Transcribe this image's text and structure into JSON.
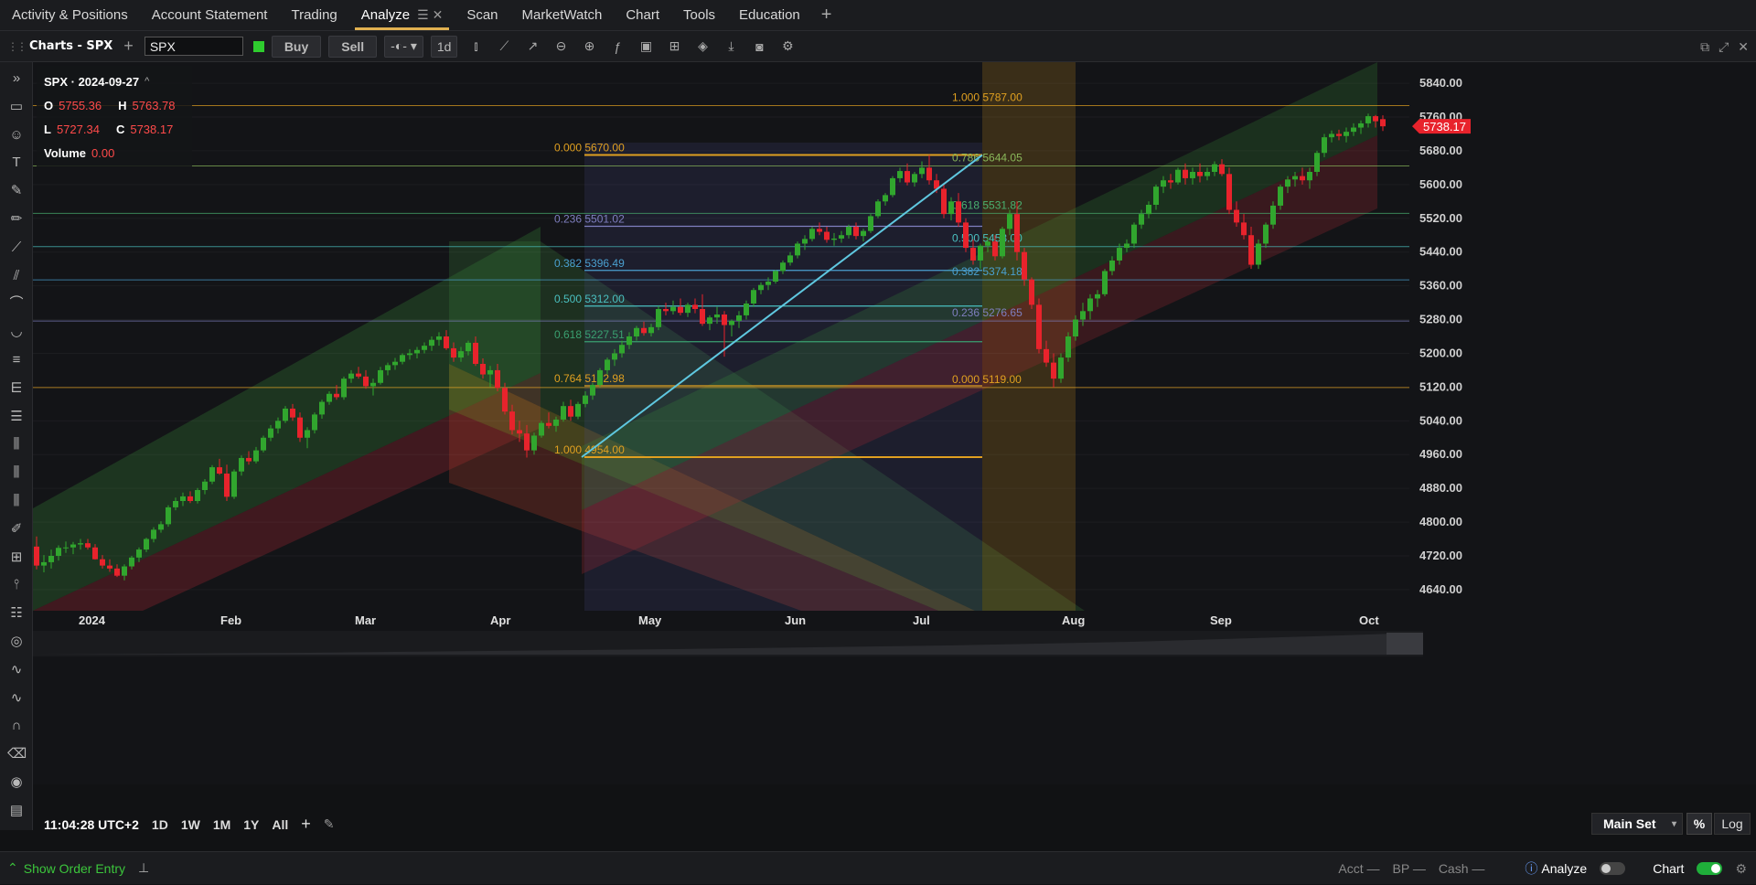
{
  "top_tabs": [
    {
      "label": "Activity & Positions"
    },
    {
      "label": "Account Statement"
    },
    {
      "label": "Trading"
    },
    {
      "label": "Analyze",
      "active": true
    },
    {
      "label": "Scan"
    },
    {
      "label": "MarketWatch"
    },
    {
      "label": "Chart"
    },
    {
      "label": "Tools"
    },
    {
      "label": "Education"
    }
  ],
  "toolbar": {
    "title": "Charts - SPX",
    "symbol": "SPX",
    "buy_label": "Buy",
    "sell_label": "Sell",
    "interval": "1d"
  },
  "ohlc": {
    "header": "SPX · 2024-09-27",
    "open": "5755.36",
    "high": "5763.78",
    "low": "5727.34",
    "close": "5738.17",
    "volume": "0.00"
  },
  "left_tools": [
    "expand-icon",
    "comment-icon",
    "emoji-icon",
    "text-icon",
    "brush-icon",
    "pencil-icon",
    "trendline-icon",
    "channel-icon",
    "arc-icon",
    "curve-icon",
    "lines-icon",
    "fib-icon",
    "parallel-icon",
    "bars-icon",
    "vlines-icon",
    "hlines-icon",
    "note-icon",
    "grid-icon",
    "pitchfork-icon",
    "pattern-icon",
    "spiral-icon",
    "wave-icon",
    "wave2-icon",
    "magnet-icon",
    "eraser-icon",
    "eye-icon",
    "layers-icon"
  ],
  "bottom": {
    "time": "11:04:28 UTC+2",
    "ranges": [
      "1D",
      "1W",
      "1M",
      "1Y",
      "All"
    ],
    "main_set": "Main Set",
    "pct": "%",
    "log": "Log"
  },
  "status": {
    "show_order": "Show Order Entry",
    "acct": "Acct —",
    "bp": "BP —",
    "cash": "Cash —",
    "analyze": "Analyze",
    "chart": "Chart"
  },
  "colors": {
    "up": "#31a62e",
    "down": "#e8232c",
    "accent": "#e0b050",
    "price_tag": "#e8232c"
  },
  "chart_data": {
    "type": "candlestick",
    "symbol": "SPX",
    "x_labels": [
      "2024",
      "Feb",
      "Mar",
      "Apr",
      "May",
      "Jun",
      "Jul",
      "Aug",
      "Sep",
      "Oct"
    ],
    "y_ticks": [
      5840,
      5760,
      5680,
      5600,
      5520,
      5440,
      5360,
      5280,
      5200,
      5120,
      5040,
      4960,
      4880,
      4800,
      4720,
      4640
    ],
    "ylim": [
      4590,
      5890
    ],
    "last_price": "5738.17",
    "candles": [
      [
        4742,
        4766,
        4688,
        4697
      ],
      [
        4697,
        4722,
        4681,
        4705
      ],
      [
        4705,
        4735,
        4690,
        4720
      ],
      [
        4720,
        4745,
        4709,
        4739
      ],
      [
        4739,
        4754,
        4727,
        4740
      ],
      [
        4740,
        4753,
        4724,
        4747
      ],
      [
        4747,
        4760,
        4735,
        4750
      ],
      [
        4750,
        4760,
        4735,
        4740
      ],
      [
        4740,
        4748,
        4711,
        4712
      ],
      [
        4712,
        4722,
        4690,
        4697
      ],
      [
        4697,
        4712,
        4682,
        4690
      ],
      [
        4690,
        4700,
        4670,
        4673
      ],
      [
        4673,
        4700,
        4662,
        4695
      ],
      [
        4695,
        4720,
        4688,
        4716
      ],
      [
        4716,
        4740,
        4705,
        4735
      ],
      [
        4735,
        4763,
        4729,
        4760
      ],
      [
        4760,
        4788,
        4752,
        4782
      ],
      [
        4782,
        4802,
        4775,
        4795
      ],
      [
        4795,
        4840,
        4789,
        4835
      ],
      [
        4835,
        4858,
        4828,
        4850
      ],
      [
        4850,
        4870,
        4838,
        4861
      ],
      [
        4861,
        4873,
        4845,
        4850
      ],
      [
        4850,
        4881,
        4844,
        4876
      ],
      [
        4876,
        4902,
        4866,
        4896
      ],
      [
        4896,
        4935,
        4890,
        4930
      ],
      [
        4930,
        4950,
        4912,
        4915
      ],
      [
        4915,
        4936,
        4850,
        4860
      ],
      [
        4860,
        4925,
        4855,
        4920
      ],
      [
        4920,
        4958,
        4910,
        4952
      ],
      [
        4952,
        4968,
        4936,
        4944
      ],
      [
        4944,
        4978,
        4939,
        4970
      ],
      [
        4970,
        5005,
        4965,
        5000
      ],
      [
        5000,
        5030,
        4992,
        5022
      ],
      [
        5022,
        5048,
        5010,
        5040
      ],
      [
        5040,
        5075,
        5035,
        5069
      ],
      [
        5069,
        5080,
        5040,
        5048
      ],
      [
        5048,
        5060,
        4990,
        5000
      ],
      [
        5000,
        5025,
        4975,
        5018
      ],
      [
        5018,
        5060,
        5010,
        5055
      ],
      [
        5055,
        5090,
        5045,
        5085
      ],
      [
        5085,
        5110,
        5078,
        5104
      ],
      [
        5104,
        5125,
        5090,
        5096
      ],
      [
        5096,
        5145,
        5090,
        5140
      ],
      [
        5140,
        5160,
        5130,
        5152
      ],
      [
        5152,
        5168,
        5140,
        5145
      ],
      [
        5145,
        5160,
        5116,
        5122
      ],
      [
        5122,
        5140,
        5100,
        5130
      ],
      [
        5130,
        5168,
        5126,
        5160
      ],
      [
        5160,
        5178,
        5148,
        5172
      ],
      [
        5172,
        5189,
        5161,
        5180
      ],
      [
        5180,
        5200,
        5174,
        5196
      ],
      [
        5196,
        5210,
        5185,
        5200
      ],
      [
        5200,
        5215,
        5188,
        5208
      ],
      [
        5208,
        5226,
        5200,
        5218
      ],
      [
        5218,
        5240,
        5206,
        5232
      ],
      [
        5232,
        5250,
        5218,
        5240
      ],
      [
        5240,
        5255,
        5208,
        5212
      ],
      [
        5212,
        5226,
        5180,
        5190
      ],
      [
        5190,
        5215,
        5180,
        5205
      ],
      [
        5205,
        5230,
        5195,
        5225
      ],
      [
        5225,
        5240,
        5170,
        5175
      ],
      [
        5175,
        5188,
        5140,
        5150
      ],
      [
        5150,
        5170,
        5120,
        5160
      ],
      [
        5160,
        5175,
        5110,
        5118
      ],
      [
        5118,
        5130,
        5055,
        5062
      ],
      [
        5062,
        5078,
        5008,
        5018
      ],
      [
        5018,
        5040,
        4990,
        5010
      ],
      [
        5010,
        5030,
        4953,
        4970
      ],
      [
        4970,
        5012,
        4960,
        5005
      ],
      [
        5005,
        5040,
        5000,
        5035
      ],
      [
        5035,
        5060,
        5022,
        5028
      ],
      [
        5028,
        5050,
        5014,
        5043
      ],
      [
        5043,
        5085,
        5038,
        5075
      ],
      [
        5075,
        5090,
        5040,
        5050
      ],
      [
        5050,
        5085,
        5044,
        5080
      ],
      [
        5080,
        5110,
        5072,
        5100
      ],
      [
        5100,
        5130,
        5090,
        5125
      ],
      [
        5125,
        5165,
        5120,
        5160
      ],
      [
        5160,
        5190,
        5150,
        5185
      ],
      [
        5185,
        5210,
        5170,
        5200
      ],
      [
        5200,
        5230,
        5190,
        5220
      ],
      [
        5220,
        5250,
        5210,
        5240
      ],
      [
        5240,
        5265,
        5230,
        5260
      ],
      [
        5260,
        5275,
        5242,
        5248
      ],
      [
        5248,
        5270,
        5240,
        5262
      ],
      [
        5262,
        5312,
        5255,
        5305
      ],
      [
        5305,
        5320,
        5290,
        5300
      ],
      [
        5300,
        5325,
        5292,
        5310
      ],
      [
        5310,
        5330,
        5290,
        5296
      ],
      [
        5296,
        5320,
        5286,
        5315
      ],
      [
        5315,
        5330,
        5295,
        5305
      ],
      [
        5305,
        5340,
        5265,
        5270
      ],
      [
        5270,
        5290,
        5255,
        5285
      ],
      [
        5285,
        5310,
        5270,
        5292
      ],
      [
        5292,
        5300,
        5192,
        5267
      ],
      [
        5267,
        5280,
        5240,
        5277
      ],
      [
        5277,
        5300,
        5260,
        5290
      ],
      [
        5290,
        5325,
        5280,
        5318
      ],
      [
        5318,
        5355,
        5310,
        5350
      ],
      [
        5350,
        5368,
        5340,
        5362
      ],
      [
        5362,
        5380,
        5350,
        5370
      ],
      [
        5370,
        5398,
        5365,
        5395
      ],
      [
        5395,
        5420,
        5388,
        5415
      ],
      [
        5415,
        5440,
        5408,
        5432
      ],
      [
        5432,
        5465,
        5425,
        5460
      ],
      [
        5460,
        5480,
        5445,
        5471
      ],
      [
        5471,
        5500,
        5465,
        5495
      ],
      [
        5495,
        5510,
        5480,
        5488
      ],
      [
        5488,
        5500,
        5462,
        5469
      ],
      [
        5469,
        5485,
        5455,
        5472
      ],
      [
        5472,
        5490,
        5462,
        5480
      ],
      [
        5480,
        5505,
        5472,
        5500
      ],
      [
        5500,
        5510,
        5470,
        5478
      ],
      [
        5478,
        5495,
        5465,
        5490
      ],
      [
        5490,
        5530,
        5485,
        5525
      ],
      [
        5525,
        5565,
        5520,
        5560
      ],
      [
        5560,
        5580,
        5550,
        5575
      ],
      [
        5575,
        5620,
        5570,
        5615
      ],
      [
        5615,
        5640,
        5605,
        5632
      ],
      [
        5632,
        5650,
        5598,
        5605
      ],
      [
        5605,
        5630,
        5595,
        5625
      ],
      [
        5625,
        5655,
        5615,
        5640
      ],
      [
        5640,
        5670,
        5600,
        5610
      ],
      [
        5610,
        5625,
        5580,
        5590
      ],
      [
        5590,
        5600,
        5520,
        5530
      ],
      [
        5530,
        5570,
        5515,
        5560
      ],
      [
        5560,
        5580,
        5500,
        5510
      ],
      [
        5510,
        5520,
        5440,
        5450
      ],
      [
        5450,
        5470,
        5410,
        5420
      ],
      [
        5420,
        5460,
        5400,
        5455
      ],
      [
        5455,
        5475,
        5440,
        5465
      ],
      [
        5465,
        5480,
        5420,
        5430
      ],
      [
        5430,
        5500,
        5425,
        5495
      ],
      [
        5495,
        5540,
        5480,
        5530
      ],
      [
        5530,
        5560,
        5420,
        5440
      ],
      [
        5440,
        5450,
        5360,
        5375
      ],
      [
        5375,
        5380,
        5305,
        5315
      ],
      [
        5315,
        5330,
        5200,
        5210
      ],
      [
        5210,
        5230,
        5168,
        5178
      ],
      [
        5178,
        5200,
        5119,
        5140
      ],
      [
        5140,
        5200,
        5130,
        5190
      ],
      [
        5190,
        5250,
        5180,
        5240
      ],
      [
        5240,
        5290,
        5230,
        5280
      ],
      [
        5280,
        5320,
        5265,
        5300
      ],
      [
        5300,
        5340,
        5280,
        5330
      ],
      [
        5330,
        5350,
        5310,
        5340
      ],
      [
        5340,
        5400,
        5335,
        5395
      ],
      [
        5395,
        5430,
        5385,
        5420
      ],
      [
        5420,
        5460,
        5410,
        5450
      ],
      [
        5450,
        5470,
        5440,
        5460
      ],
      [
        5460,
        5510,
        5450,
        5505
      ],
      [
        5505,
        5540,
        5495,
        5530
      ],
      [
        5530,
        5560,
        5520,
        5552
      ],
      [
        5552,
        5600,
        5540,
        5595
      ],
      [
        5595,
        5620,
        5580,
        5610
      ],
      [
        5610,
        5625,
        5590,
        5605
      ],
      [
        5605,
        5640,
        5600,
        5635
      ],
      [
        5635,
        5650,
        5600,
        5615
      ],
      [
        5615,
        5640,
        5600,
        5630
      ],
      [
        5630,
        5650,
        5605,
        5620
      ],
      [
        5620,
        5640,
        5610,
        5630
      ],
      [
        5630,
        5655,
        5620,
        5648
      ],
      [
        5648,
        5660,
        5620,
        5625
      ],
      [
        5625,
        5640,
        5530,
        5540
      ],
      [
        5540,
        5560,
        5500,
        5510
      ],
      [
        5510,
        5530,
        5470,
        5480
      ],
      [
        5480,
        5500,
        5400,
        5410
      ],
      [
        5410,
        5470,
        5400,
        5460
      ],
      [
        5460,
        5510,
        5450,
        5505
      ],
      [
        5505,
        5560,
        5495,
        5550
      ],
      [
        5550,
        5600,
        5540,
        5595
      ],
      [
        5595,
        5620,
        5580,
        5612
      ],
      [
        5612,
        5630,
        5595,
        5620
      ],
      [
        5620,
        5640,
        5600,
        5610
      ],
      [
        5610,
        5640,
        5590,
        5630
      ],
      [
        5630,
        5680,
        5620,
        5675
      ],
      [
        5675,
        5720,
        5665,
        5712
      ],
      [
        5712,
        5728,
        5700,
        5720
      ],
      [
        5720,
        5730,
        5705,
        5715
      ],
      [
        5715,
        5735,
        5700,
        5725
      ],
      [
        5725,
        5745,
        5715,
        5735
      ],
      [
        5735,
        5752,
        5720,
        5745
      ],
      [
        5745,
        5768,
        5735,
        5762
      ],
      [
        5762,
        5765,
        5735,
        5750
      ],
      [
        5755,
        5764,
        5727,
        5738
      ]
    ],
    "fib_left": {
      "levels": [
        {
          "ratio": "0.000",
          "price": "5670.00"
        },
        {
          "ratio": "0.236",
          "price": "5501.02"
        },
        {
          "ratio": "0.382",
          "price": "5396.49"
        },
        {
          "ratio": "0.500",
          "price": "5312.00"
        },
        {
          "ratio": "0.618",
          "price": "5227.51"
        },
        {
          "ratio": "0.764",
          "price": "5122.98"
        },
        {
          "ratio": "1.000",
          "price": "4954.00"
        }
      ]
    },
    "fib_right": {
      "levels": [
        {
          "ratio": "1.000",
          "price": "5787.00"
        },
        {
          "ratio": "0.786",
          "price": "5644.05"
        },
        {
          "ratio": "0.618",
          "price": "5531.82"
        },
        {
          "ratio": "0.500",
          "price": "5453.00"
        },
        {
          "ratio": "0.382",
          "price": "5374.18"
        },
        {
          "ratio": "0.236",
          "price": "5276.65"
        },
        {
          "ratio": "0.000",
          "price": "5119.00"
        }
      ]
    }
  }
}
